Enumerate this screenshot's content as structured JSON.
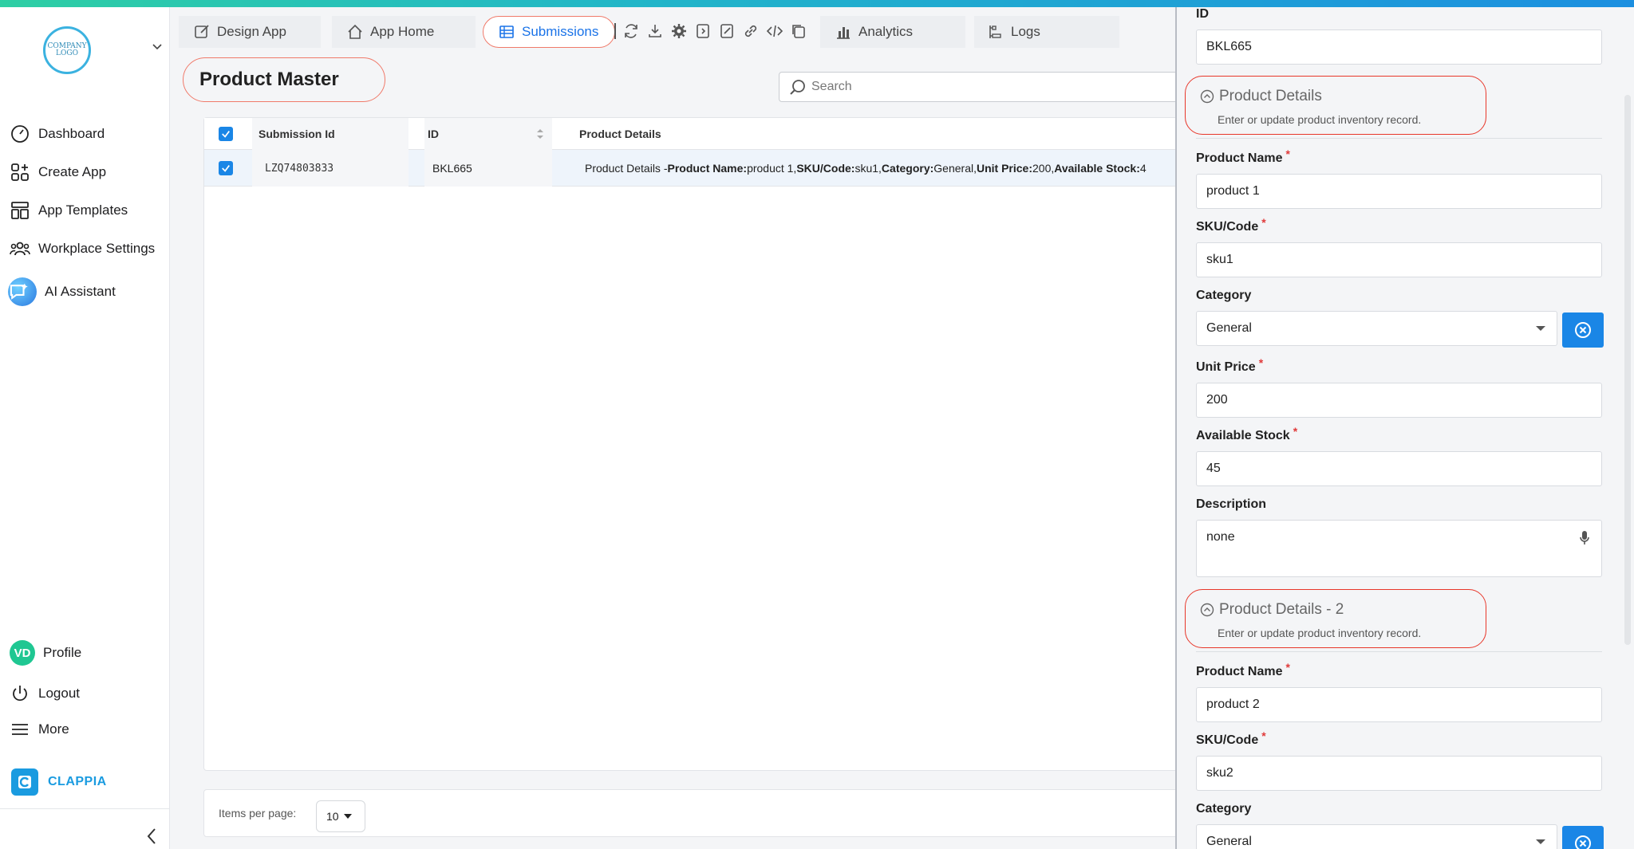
{
  "sidebar": {
    "logo_text": "COMPANY LOGO",
    "items": [
      {
        "label": "Dashboard"
      },
      {
        "label": "Create App"
      },
      {
        "label": "App Templates"
      },
      {
        "label": "Workplace Settings"
      },
      {
        "label": "AI Assistant"
      }
    ],
    "bottom": {
      "profile_initials": "VD",
      "profile_label": "Profile",
      "logout_label": "Logout",
      "more_label": "More"
    },
    "brand": "CLAPPIA"
  },
  "tabs": [
    {
      "label": "Design App"
    },
    {
      "label": "App Home"
    },
    {
      "label": "Submissions",
      "active": true
    },
    {
      "label": "Analytics"
    },
    {
      "label": "Logs"
    }
  ],
  "page": {
    "title": "Product Master",
    "search_placeholder": "Search"
  },
  "table": {
    "columns": [
      "Submission Id",
      "ID",
      "Product Details"
    ],
    "rows": [
      {
        "submission_id": "LZQ74803833",
        "id": "BKL665",
        "details_prefix": "Product Details - ",
        "details_parts": [
          {
            "k": "Product Name:",
            "v": " product 1, "
          },
          {
            "k": "SKU/Code:",
            "v": " sku1, "
          },
          {
            "k": "Category:",
            "v": " General, "
          },
          {
            "k": "Unit Price:",
            "v": " 200, "
          },
          {
            "k": "Available Stock:",
            "v": " 4"
          }
        ]
      }
    ]
  },
  "pager": {
    "label": "Items per page:",
    "value": "10"
  },
  "panel": {
    "id_label": "ID",
    "id_value": "BKL665",
    "section1": {
      "title": "Product Details",
      "subtitle": "Enter or update product inventory record."
    },
    "product_name_label": "Product Name",
    "product_name_1": "product 1",
    "sku_label": "SKU/Code",
    "sku_1": "sku1",
    "category_label": "Category",
    "category_1": "General",
    "unit_price_label": "Unit Price",
    "unit_price_1": "200",
    "stock_label": "Available Stock",
    "stock_1": "45",
    "description_label": "Description",
    "description_1": "none",
    "section2": {
      "title": "Product Details - 2",
      "subtitle": "Enter or update product inventory record."
    },
    "product_name_2": "product 2",
    "sku_2": "sku2",
    "category_2": "General",
    "required_mark": "*"
  },
  "colors": {
    "accent": "#1a86e6",
    "highlight_ring": "#e8372a",
    "brand": "#1a9be0"
  }
}
